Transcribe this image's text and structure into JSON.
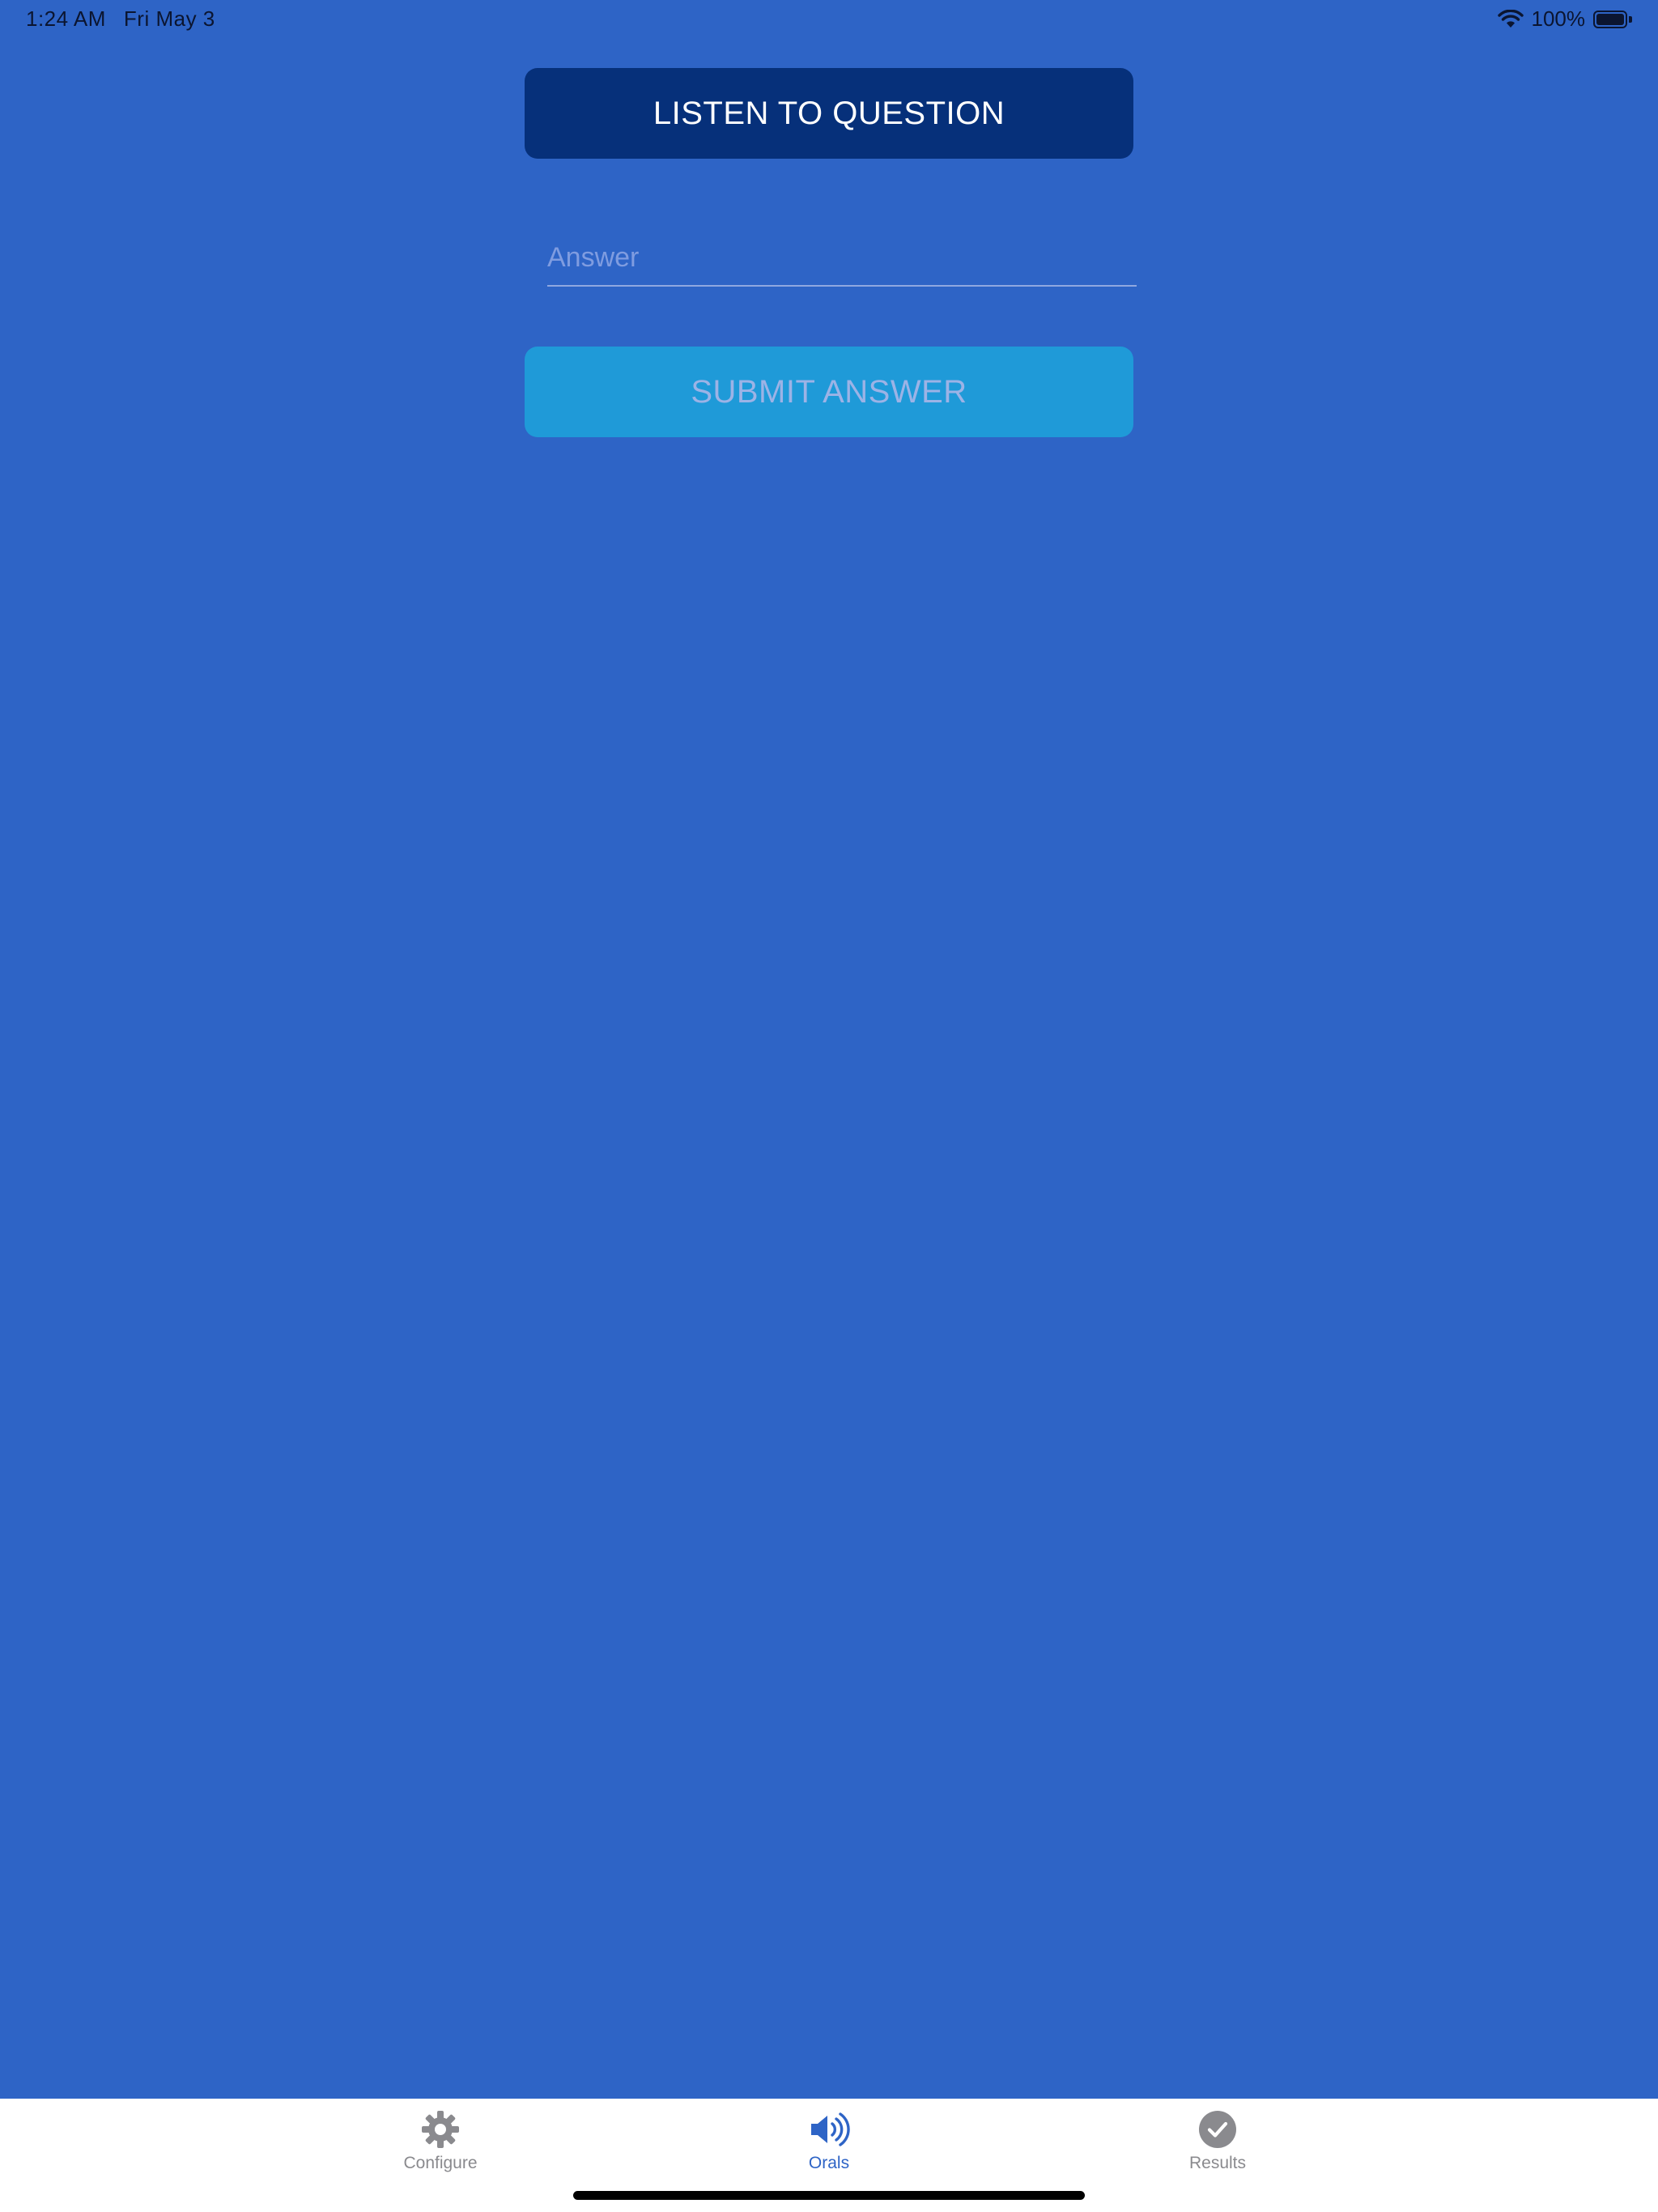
{
  "status_bar": {
    "time": "1:24 AM",
    "date": "Fri May 3",
    "battery_percent": "100%",
    "battery_level": 1.0
  },
  "main": {
    "listen_label": "LISTEN TO QUESTION",
    "answer_placeholder": "Answer",
    "answer_value": "",
    "submit_label": "SUBMIT ANSWER"
  },
  "tab_bar": {
    "selected": "Orals",
    "tabs": [
      {
        "label": "Configure",
        "icon": "gear-icon"
      },
      {
        "label": "Orals",
        "icon": "speaker-icon"
      },
      {
        "label": "Results",
        "icon": "checkmark-circle-icon"
      }
    ]
  },
  "colors": {
    "background": "#2E64C6",
    "listen_button": "#06307A",
    "submit_button": "#1F9AD8",
    "tab_active": "#2E64C6",
    "tab_inactive": "#8a8a8e"
  }
}
